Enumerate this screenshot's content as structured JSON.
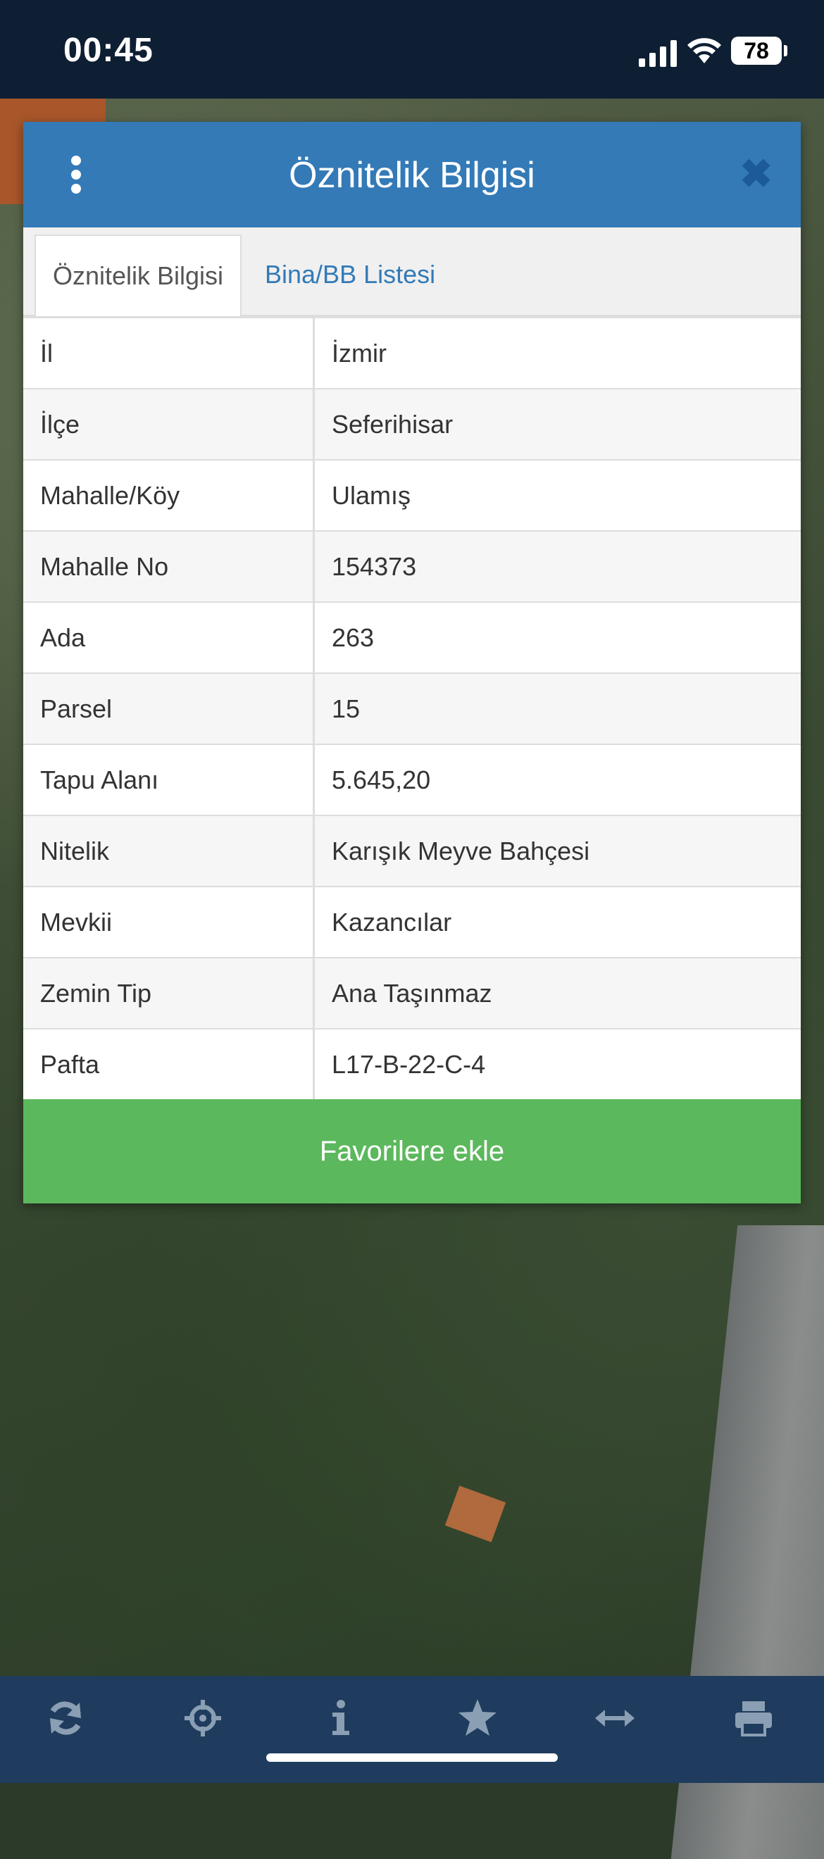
{
  "status": {
    "time": "00:45",
    "battery": "78"
  },
  "modal": {
    "title": "Öznitelik Bilgisi",
    "tabs": [
      {
        "label": "Öznitelik Bilgisi",
        "active": true
      },
      {
        "label": "Bina/BB Listesi",
        "active": false
      }
    ],
    "rows": [
      {
        "key": "İl",
        "value": "İzmir"
      },
      {
        "key": "İlçe",
        "value": "Seferihisar"
      },
      {
        "key": "Mahalle/Köy",
        "value": "Ulamış"
      },
      {
        "key": "Mahalle No",
        "value": "154373"
      },
      {
        "key": "Ada",
        "value": "263"
      },
      {
        "key": "Parsel",
        "value": "15"
      },
      {
        "key": "Tapu Alanı",
        "value": "5.645,20"
      },
      {
        "key": "Nitelik",
        "value": "Karışık Meyve Bahçesi"
      },
      {
        "key": "Mevkii",
        "value": "Kazancılar"
      },
      {
        "key": "Zemin Tip",
        "value": "Ana Taşınmaz"
      },
      {
        "key": "Pafta",
        "value": "L17-B-22-C-4"
      }
    ],
    "favorite_label": "Favorilere ekle"
  },
  "toolbar": {
    "icons": [
      "refresh-icon",
      "locate-icon",
      "info-icon",
      "star-icon",
      "measure-icon",
      "print-icon"
    ]
  },
  "colors": {
    "header": "#337ab7",
    "button": "#5cb85c",
    "toolbar": "#1f3c5e"
  }
}
